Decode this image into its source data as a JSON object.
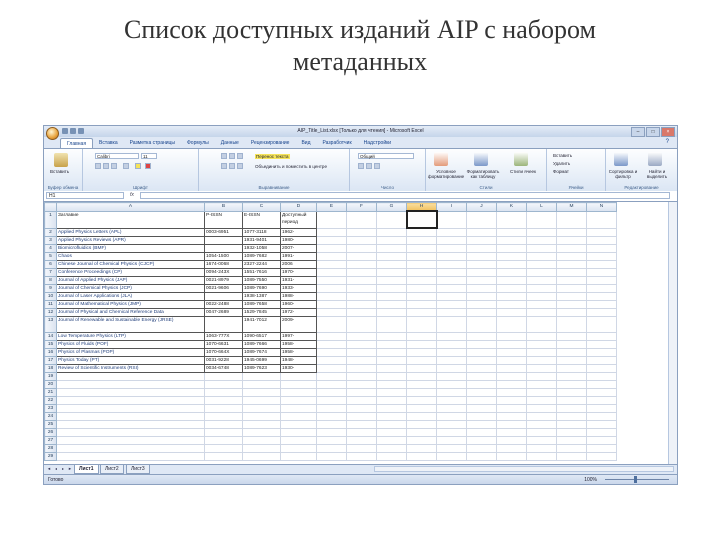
{
  "slide": {
    "title_line1": "Список доступных изданий AIP с набором",
    "title_line2": "метаданных"
  },
  "window": {
    "title": "AIP_Title_List.xlsx [Только для чтения] - Microsoft Excel",
    "controls": [
      "–",
      "□",
      "×"
    ]
  },
  "ribbon": {
    "tabs": [
      "Главная",
      "Вставка",
      "Разметка страницы",
      "Формулы",
      "Данные",
      "Рецензирование",
      "Вид",
      "Разработчик",
      "Надстройки"
    ],
    "help": "?",
    "clipboard": {
      "paste": "Вставить",
      "group": "Буфер обмена"
    },
    "font": {
      "name": "Calibri",
      "size": "11",
      "group": "Шрифт"
    },
    "alignment": {
      "wrap": "Перенос текста",
      "merge": "Объединить и поместить в центре",
      "group": "Выравнивание"
    },
    "number": {
      "format": "Общий",
      "group": "Число"
    },
    "styles": {
      "conditional": "Условное форматирование",
      "as_table": "Форматировать как таблицу",
      "cell_styles": "Стили ячеек",
      "group": "Стили"
    },
    "cells": {
      "insert": "Вставить",
      "delete": "Удалить",
      "format": "Формат",
      "group": "Ячейки"
    },
    "editing": {
      "sort": "Сортировка и фильтр",
      "find": "Найти и выделить",
      "group": "Редактирование"
    }
  },
  "formula_bar": {
    "cell_ref": "H1",
    "fx": "fx",
    "value": ""
  },
  "sheet": {
    "columns": [
      "A",
      "B",
      "C",
      "D",
      "E",
      "F",
      "G",
      "H",
      "I",
      "J",
      "K",
      "L",
      "M",
      "N"
    ],
    "selected_column": "H",
    "rows": [
      {
        "n": "1",
        "a": "Заглавие",
        "b": "P-ISSN",
        "c": "E-ISSN",
        "d": "Доступный период",
        "tall": true
      },
      {
        "n": "2",
        "a": "Applied Physics Letters (APL)",
        "b": "0003-6951",
        "c": "1077-3118",
        "d": "1962-"
      },
      {
        "n": "3",
        "a": "Applied Physics Reviews (APR)",
        "b": "",
        "c": "1931-9401",
        "d": "1980-"
      },
      {
        "n": "4",
        "a": "Biomicrofluidics (BMF)",
        "b": "",
        "c": "1932-1058",
        "d": "2007-"
      },
      {
        "n": "5",
        "a": "Chaos",
        "b": "1054-1500",
        "c": "1089-7682",
        "d": "1991-"
      },
      {
        "n": "6",
        "a": "Chinese Journal of Chemical Physics (CJCP)",
        "b": "1674-0068",
        "c": "2327-2244",
        "d": "2006"
      },
      {
        "n": "7",
        "a": "Conference Proceedings (CP)",
        "b": "0094-243X",
        "c": "1551-7616",
        "d": "1970-"
      },
      {
        "n": "8",
        "a": "Journal of Applied Physics (JAP)",
        "b": "0021-8979",
        "c": "1089-7550",
        "d": "1931-"
      },
      {
        "n": "9",
        "a": "Journal of Chemical Physics (JCP)",
        "b": "0021-9606",
        "c": "1089-7690",
        "d": "1933-"
      },
      {
        "n": "10",
        "a": "Journal of Laser Applications (JLA)",
        "b": "",
        "c": "1938-1387",
        "d": "1988-"
      },
      {
        "n": "11",
        "a": "Journal of Mathematical Physics (JMP)",
        "b": "0022-2488",
        "c": "1089-7658",
        "d": "1960-"
      },
      {
        "n": "12",
        "a": "Journal of Physical and Chemical Reference Data",
        "b": "0047-2689",
        "c": "1529-7845",
        "d": "1972-"
      },
      {
        "n": "13",
        "a": "Journal of Renewable and Sustainable Energy (JRSE)",
        "b": "",
        "c": "1941-7012",
        "d": "2009-",
        "tall": true
      },
      {
        "n": "14",
        "a": "Low Temperature Physics (LTP)",
        "b": "1063-777X",
        "c": "1090-6517",
        "d": "1997-"
      },
      {
        "n": "15",
        "a": "Physics of Fluids (POF)",
        "b": "1070-6631",
        "c": "1089-7666",
        "d": "1958-"
      },
      {
        "n": "16",
        "a": "Physics of Plasmas (POP)",
        "b": "1070-664X",
        "c": "1089-7674",
        "d": "1958-"
      },
      {
        "n": "17",
        "a": "Physics Today (PT)",
        "b": "0031-9228",
        "c": "1945-0699",
        "d": "1948-"
      },
      {
        "n": "18",
        "a": "Review of Scientific Instruments (RSI)",
        "b": "0034-6748",
        "c": "1089-7623",
        "d": "1930-"
      },
      {
        "n": "19"
      },
      {
        "n": "20"
      },
      {
        "n": "21"
      },
      {
        "n": "22"
      },
      {
        "n": "23"
      },
      {
        "n": "24"
      },
      {
        "n": "25"
      },
      {
        "n": "26"
      },
      {
        "n": "27"
      },
      {
        "n": "28"
      },
      {
        "n": "29"
      }
    ]
  },
  "sheet_tabs": [
    "Лист1",
    "Лист2",
    "Лист3"
  ],
  "status": {
    "mode": "Готово",
    "zoom": "100%"
  }
}
